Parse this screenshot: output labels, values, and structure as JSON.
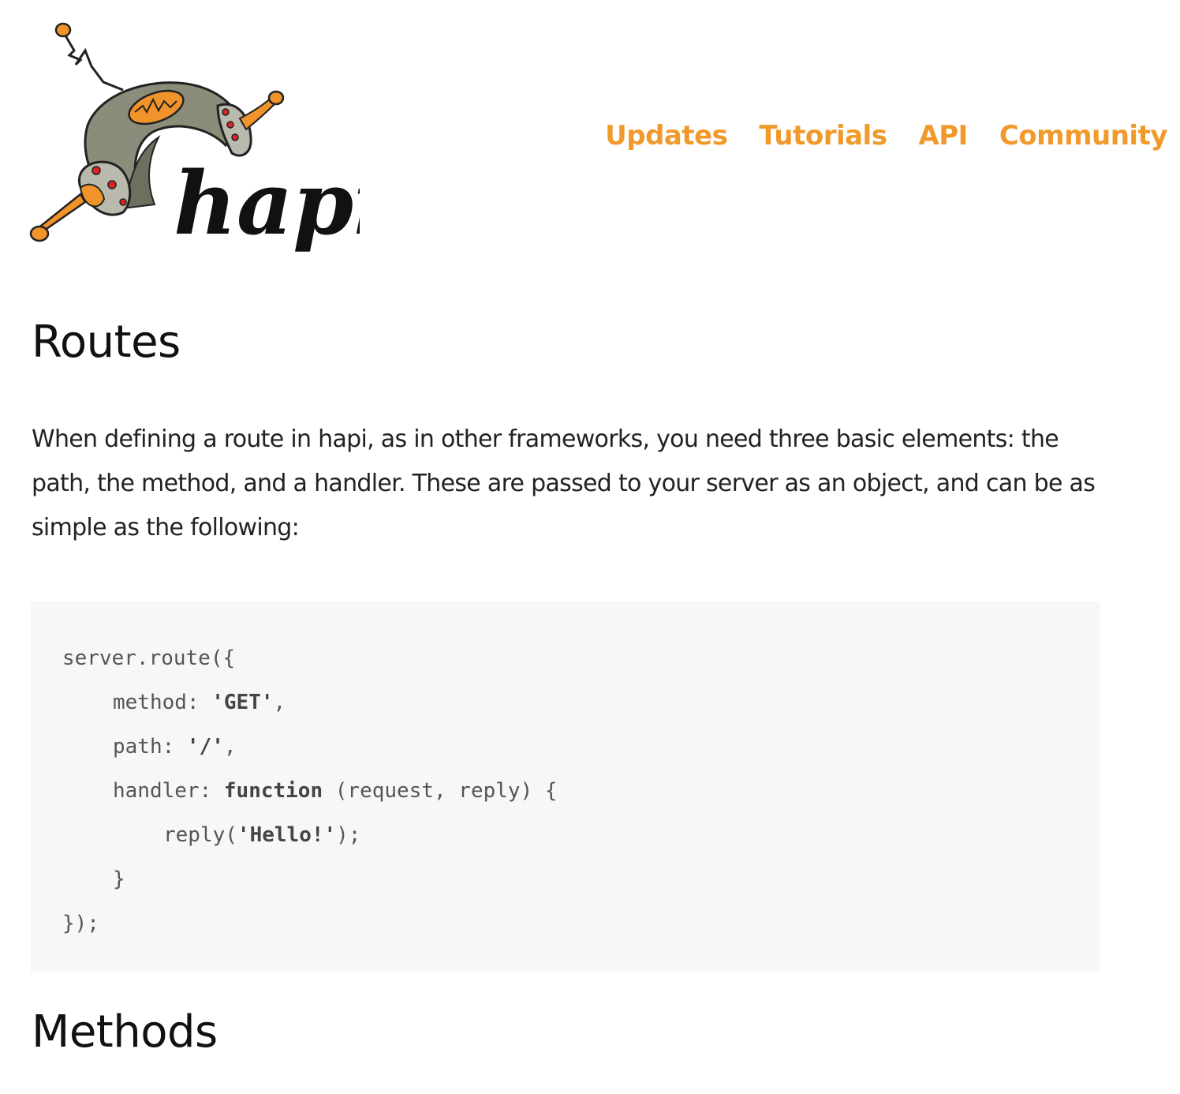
{
  "header": {
    "logo_text": "hapi",
    "nav": [
      {
        "label": "Updates"
      },
      {
        "label": "Tutorials"
      },
      {
        "label": "API"
      },
      {
        "label": "Community"
      }
    ]
  },
  "main": {
    "title": "Routes",
    "intro": "When defining a route in hapi, as in other frameworks, you need three basic elements: the path, the method, and a handler. These are passed to your server as an object, and can be as simple as the following:",
    "code": {
      "line1": "server.route({",
      "line2_key": "method: ",
      "line2_val": "'GET'",
      "line2_end": ",",
      "line3_key": "path: ",
      "line3_val": "'/'",
      "line3_end": ",",
      "line4_key": "handler: ",
      "line4_kw": "function",
      "line4_end": " (request, reply) {",
      "line5_start": "reply(",
      "line5_val": "'Hello!'",
      "line5_end": ");",
      "line6": "}",
      "line7": "});"
    },
    "next_heading": "Methods"
  },
  "colors": {
    "nav_orange": "#f19a2c",
    "code_bg": "#f7f7f7"
  }
}
